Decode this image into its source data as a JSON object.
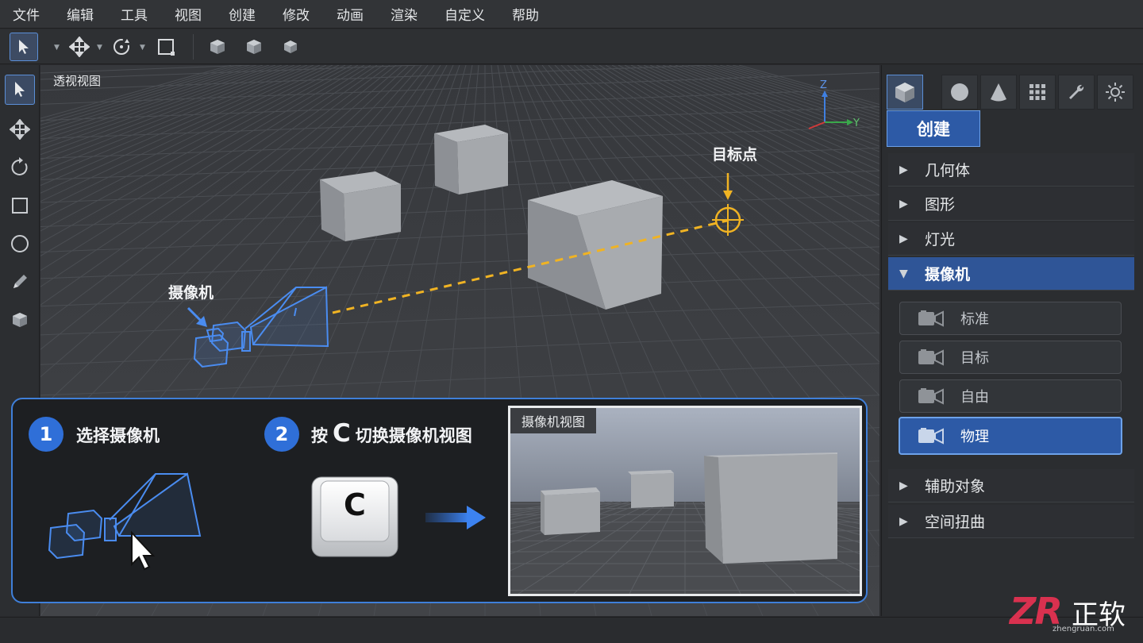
{
  "menu": [
    "文件",
    "编辑",
    "工具",
    "视图",
    "创建",
    "修改",
    "动画",
    "渲染",
    "自定义",
    "帮助"
  ],
  "viewport": {
    "label": "透视视图",
    "axis_z": "Z",
    "axis_y": "Y",
    "camera_label": "摄像机",
    "target_label": "目标点"
  },
  "right_panel": {
    "create_button": "创建",
    "categories": [
      {
        "label": "几何体",
        "expanded": false
      },
      {
        "label": "图形",
        "expanded": false
      },
      {
        "label": "灯光",
        "expanded": false
      },
      {
        "label": "摄像机",
        "expanded": true
      },
      {
        "label": "辅助对象",
        "expanded": false
      },
      {
        "label": "空间扭曲",
        "expanded": false
      }
    ],
    "camera_types": [
      {
        "label": "标准",
        "selected": false
      },
      {
        "label": "目标",
        "selected": false
      },
      {
        "label": "自由",
        "selected": false
      },
      {
        "label": "物理",
        "selected": true
      }
    ]
  },
  "info": {
    "step1_num": "1",
    "step1_text": "选择摄像机",
    "step2_num": "2",
    "step2_pre": "按",
    "step2_key": "C",
    "step2_post": "切换摄像机视图",
    "key_label": "C",
    "camview_label": "摄像机视图"
  },
  "watermark": {
    "logo": "ZR",
    "name": "正软",
    "url": "zhengruan.com"
  },
  "colors": {
    "accent": "#2f6fd8",
    "selection_blue": "#2d5aa6",
    "camera_wire": "#4a8cf0",
    "target_yellow": "#f0b323",
    "watermark_red": "#d9314f"
  }
}
